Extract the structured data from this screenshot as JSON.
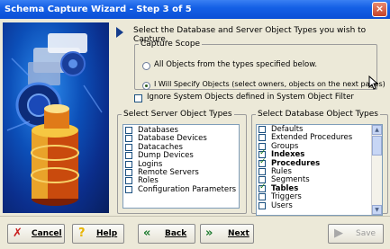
{
  "window": {
    "title": "Schema Capture Wizard - Step 3 of 5",
    "close_glyph": "×"
  },
  "instruction": "Select the Database and Server Object Types you wish to Capture.",
  "capture_scope": {
    "legend": "Capture Scope",
    "options": [
      {
        "label": "All Objects from the types specified below.",
        "selected": false
      },
      {
        "label": "I Will Specify Objects (select owners, objects on the next pages)",
        "selected": true
      }
    ]
  },
  "ignore_system": {
    "label": "Ignore System Objects defined in System Object Filter",
    "checked": false
  },
  "server_types": {
    "legend": "Select Server Object Types",
    "items": [
      {
        "label": "Databases",
        "checked": false
      },
      {
        "label": "Database Devices",
        "checked": false
      },
      {
        "label": "Datacaches",
        "checked": false
      },
      {
        "label": "Dump Devices",
        "checked": false
      },
      {
        "label": "Logins",
        "checked": false
      },
      {
        "label": "Remote Servers",
        "checked": false
      },
      {
        "label": "Roles",
        "checked": false
      },
      {
        "label": "Configuration Parameters",
        "checked": false
      }
    ]
  },
  "database_types": {
    "legend": "Select Database Object Types",
    "items": [
      {
        "label": "Defaults",
        "checked": false
      },
      {
        "label": "Extended Procedures",
        "checked": false
      },
      {
        "label": "Groups",
        "checked": false
      },
      {
        "label": "Indexes",
        "checked": true
      },
      {
        "label": "Procedures",
        "checked": true
      },
      {
        "label": "Rules",
        "checked": false
      },
      {
        "label": "Segments",
        "checked": false
      },
      {
        "label": "Tables",
        "checked": true
      },
      {
        "label": "Triggers",
        "checked": false
      },
      {
        "label": "Users",
        "checked": false
      }
    ]
  },
  "buttons": {
    "cancel": {
      "label": "Cancel",
      "icon": "x-icon"
    },
    "help": {
      "label": "Help",
      "icon": "question-icon"
    },
    "back": {
      "label": "Back",
      "icon": "double-left-arrow-icon"
    },
    "next": {
      "label": "Next",
      "icon": "double-right-arrow-icon"
    },
    "save": {
      "label": "Save",
      "icon": "play-icon",
      "enabled": false
    }
  },
  "colors": {
    "title_bar": "#0b4fd6",
    "cancel_icon": "#c81e1e",
    "help_icon": "#e8b400",
    "nav_arrows": "#1c7a2e",
    "accent_arrow": "#143c8c"
  }
}
